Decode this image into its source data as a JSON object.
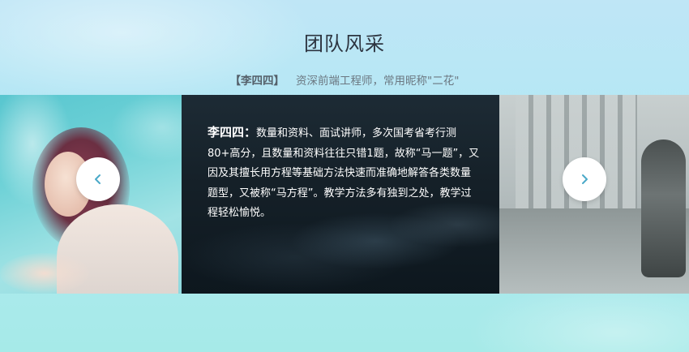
{
  "section": {
    "title": "团队风采",
    "subtitle_name": "【李四四】",
    "subtitle_desc": "资深前端工程师，常用昵称\"二花\""
  },
  "slide": {
    "name": "李四四：",
    "description": "数量和资料、面试讲师，多次国考省考行测80+高分，且数量和资料往往只错1题，故称“马一题”，又因及其擅长用方程等基础方法快速而准确地解答各类数量题型，又被称“马方程”。教学方法多有独到之处，教学过程轻松愉悦。"
  },
  "controls": {
    "prev_icon": "chevron-left-icon",
    "next_icon": "chevron-right-icon",
    "accent_color": "#4aa9c8"
  }
}
